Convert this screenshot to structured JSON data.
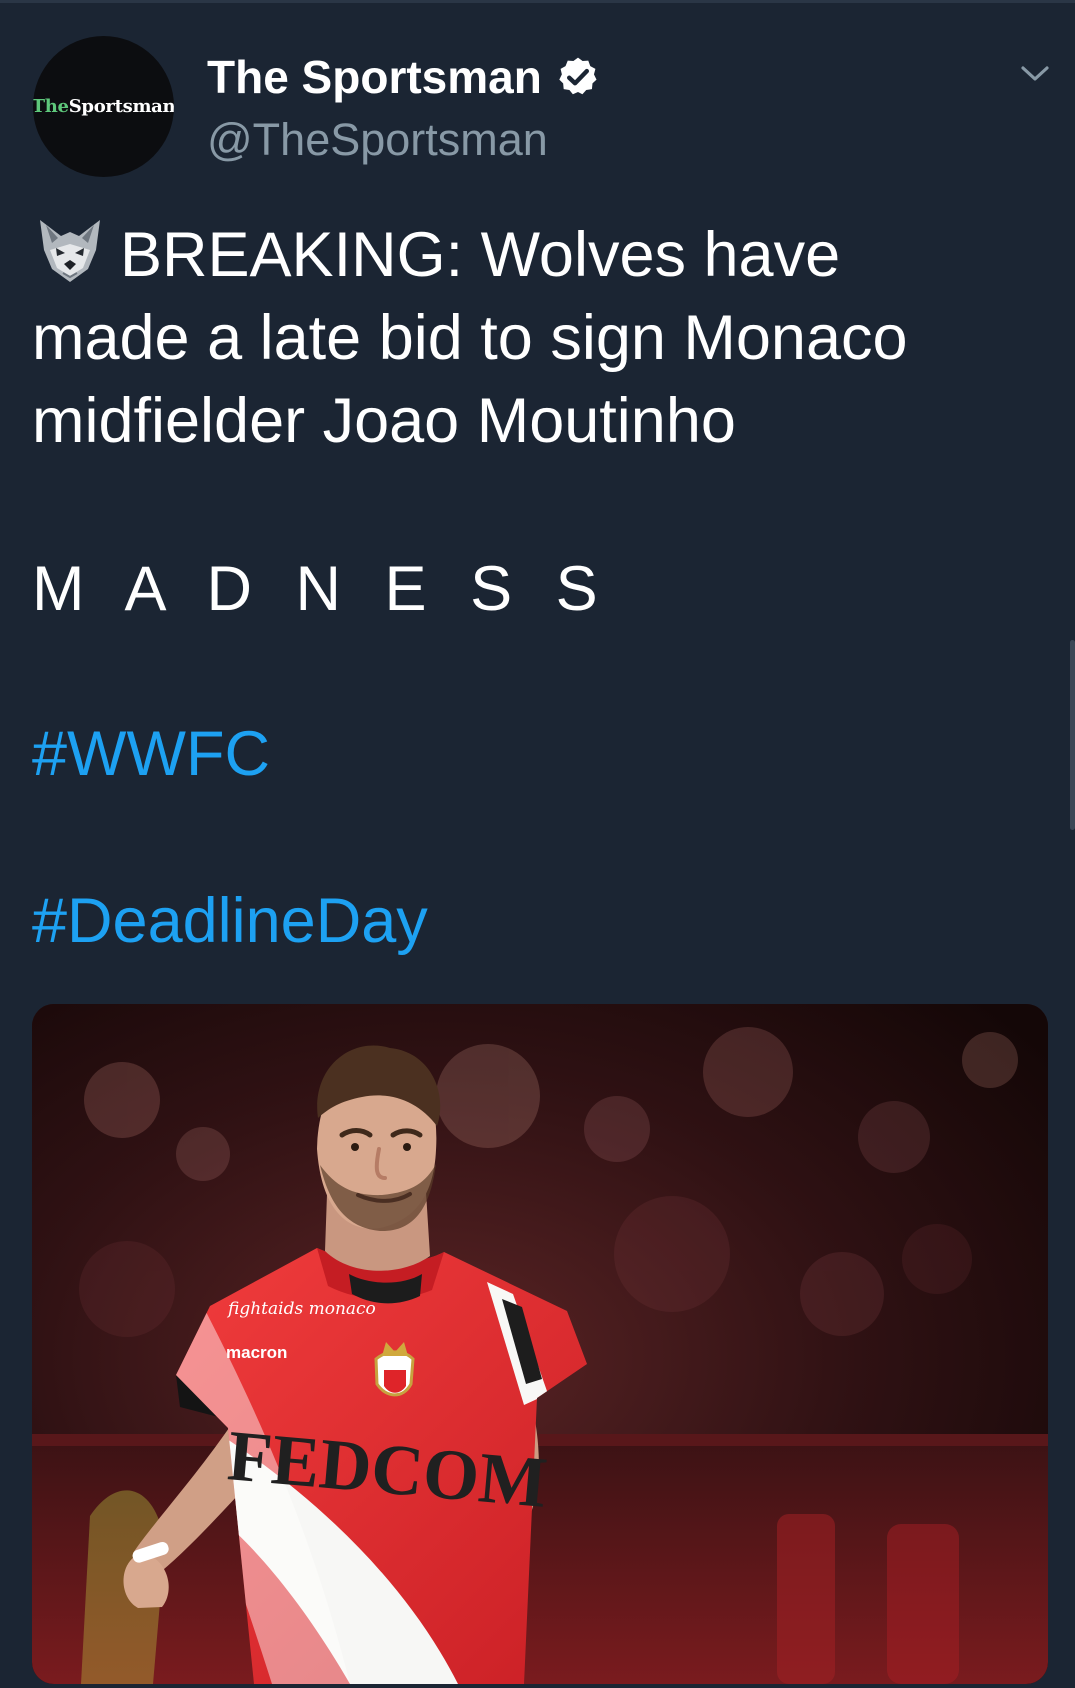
{
  "tweet": {
    "author": {
      "display_name": "The Sportsman",
      "handle": "@TheSportsman",
      "verified": true,
      "avatar_logo_prefix": "The",
      "avatar_logo_suffix": "Sportsman"
    },
    "text_lines": [
      "BREAKING: Wolves have",
      "made a late bid to sign Monaco",
      "midfielder Joao Moutinho"
    ],
    "emphasis": "M A D N E S S",
    "hashtags": [
      "#WWFC",
      "#DeadlineDay"
    ],
    "media": {
      "shirt_sponsor": "FEDCOM",
      "shirt_brand": "macron",
      "shirt_badge_text": "fightaids monaco"
    },
    "icons": {
      "leading_emoji": "wolf-icon",
      "verified": "verified-badge-icon",
      "menu": "chevron-down-icon"
    }
  },
  "colors": {
    "background": "#1b2533",
    "text": "#ffffff",
    "secondary_text": "#8899a6",
    "link": "#1da1f2",
    "logo_accent": "#5ec77b"
  }
}
